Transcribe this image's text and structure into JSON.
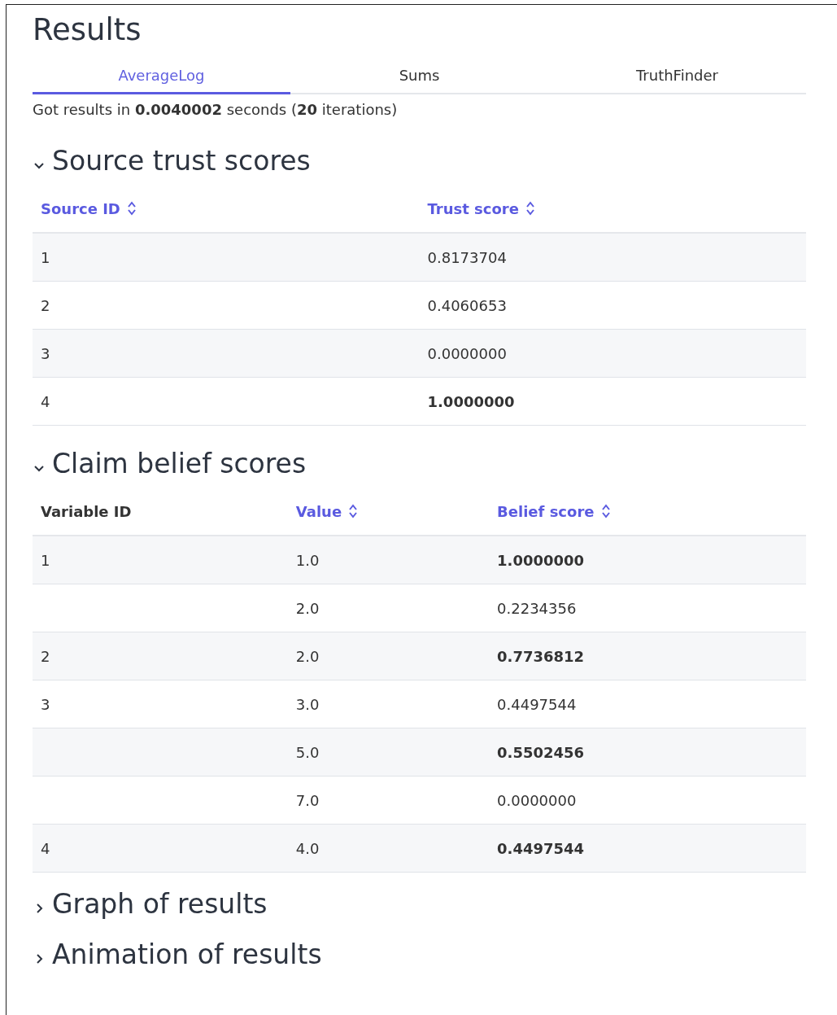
{
  "title": "Results",
  "tabs": [
    {
      "label": "AverageLog",
      "selected": true
    },
    {
      "label": "Sums",
      "selected": false
    },
    {
      "label": "TruthFinder",
      "selected": false
    }
  ],
  "summary": "Got results in **0.0040002** seconds (**20** iterations)",
  "sections": [
    {
      "title": "Source trust scores",
      "expanded": true,
      "table": {
        "columns": [
          {
            "label": "Source ID",
            "sortable": true
          },
          {
            "label": "Trust score",
            "sortable": true
          }
        ],
        "rows": [
          {
            "cells": [
              "1",
              "0.8173704"
            ],
            "highlight": false
          },
          {
            "cells": [
              "2",
              "0.4060653"
            ],
            "highlight": false
          },
          {
            "cells": [
              "3",
              "0.0000000"
            ],
            "highlight": false
          },
          {
            "cells": [
              "4",
              "1.0000000"
            ],
            "highlight": true
          }
        ]
      }
    },
    {
      "title": "Claim belief scores",
      "expanded": true,
      "table": {
        "columns": [
          {
            "label": "Variable ID",
            "sortable": false
          },
          {
            "label": "Value",
            "sortable": true
          },
          {
            "label": "Belief score",
            "sortable": true
          }
        ],
        "rows": [
          {
            "cells": [
              "1",
              "1.0",
              "1.0000000"
            ],
            "highlight": true
          },
          {
            "cells": [
              "",
              "2.0",
              "0.2234356"
            ],
            "highlight": false
          },
          {
            "cells": [
              "2",
              "2.0",
              "0.7736812"
            ],
            "highlight": true
          },
          {
            "cells": [
              "3",
              "3.0",
              "0.4497544"
            ],
            "highlight": false
          },
          {
            "cells": [
              "",
              "5.0",
              "0.5502456"
            ],
            "highlight": true
          },
          {
            "cells": [
              "",
              "7.0",
              "0.0000000"
            ],
            "highlight": false
          },
          {
            "cells": [
              "4",
              "4.0",
              "0.4497544"
            ],
            "highlight": true
          }
        ]
      }
    },
    {
      "title": "Graph of results",
      "expanded": false
    },
    {
      "title": "Animation of results",
      "expanded": false
    }
  ]
}
